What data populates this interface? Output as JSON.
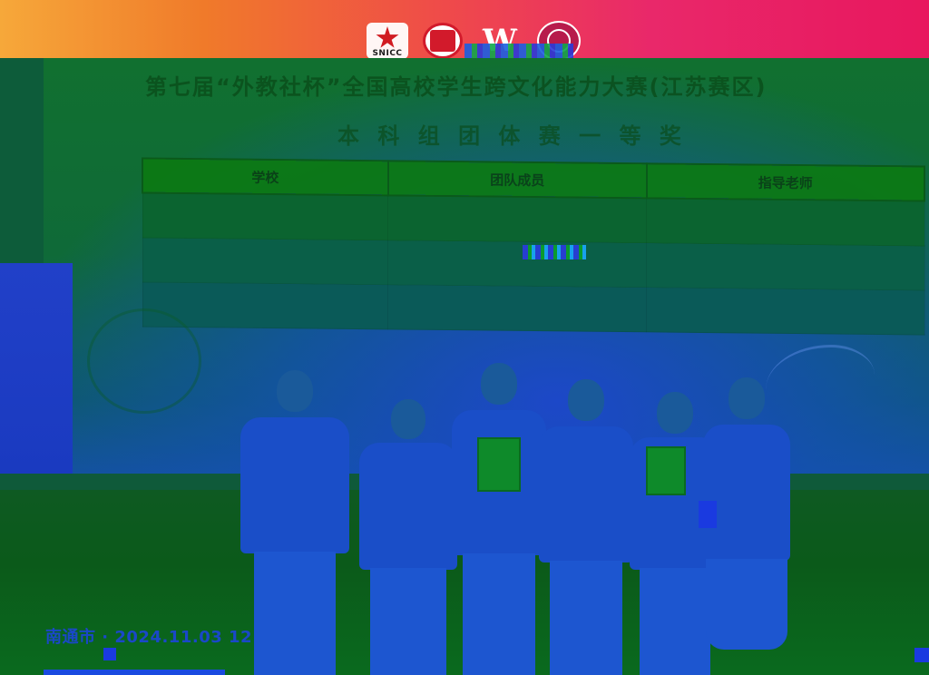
{
  "banner": {
    "logos": [
      {
        "icon": "star-logo-icon",
        "label": "SNICC"
      },
      {
        "icon": "university-seal-icon",
        "label": "1949"
      },
      {
        "icon": "w-logo-icon",
        "label": "W"
      },
      {
        "icon": "circle-seal-icon",
        "label": ""
      }
    ]
  },
  "screen": {
    "headline": "第七届“外教社杯”全国高校学生跨文化能力大赛(江苏赛区)",
    "subline": "本 科 组 团 体 赛 一 等 奖",
    "table": {
      "headers": [
        "学校",
        "团队成员",
        "指导老师"
      ],
      "rows": [
        [
          "",
          "",
          ""
        ],
        [
          "",
          "",
          ""
        ],
        [
          "",
          "",
          ""
        ]
      ]
    }
  },
  "photo": {
    "timestamp": "南通市 · 2024.11.03 12"
  },
  "colors": {
    "banner_start": "#f6a83a",
    "banner_end": "#e8175e",
    "screen_green": "#117030",
    "blue_cast": "#1a4ec8"
  }
}
